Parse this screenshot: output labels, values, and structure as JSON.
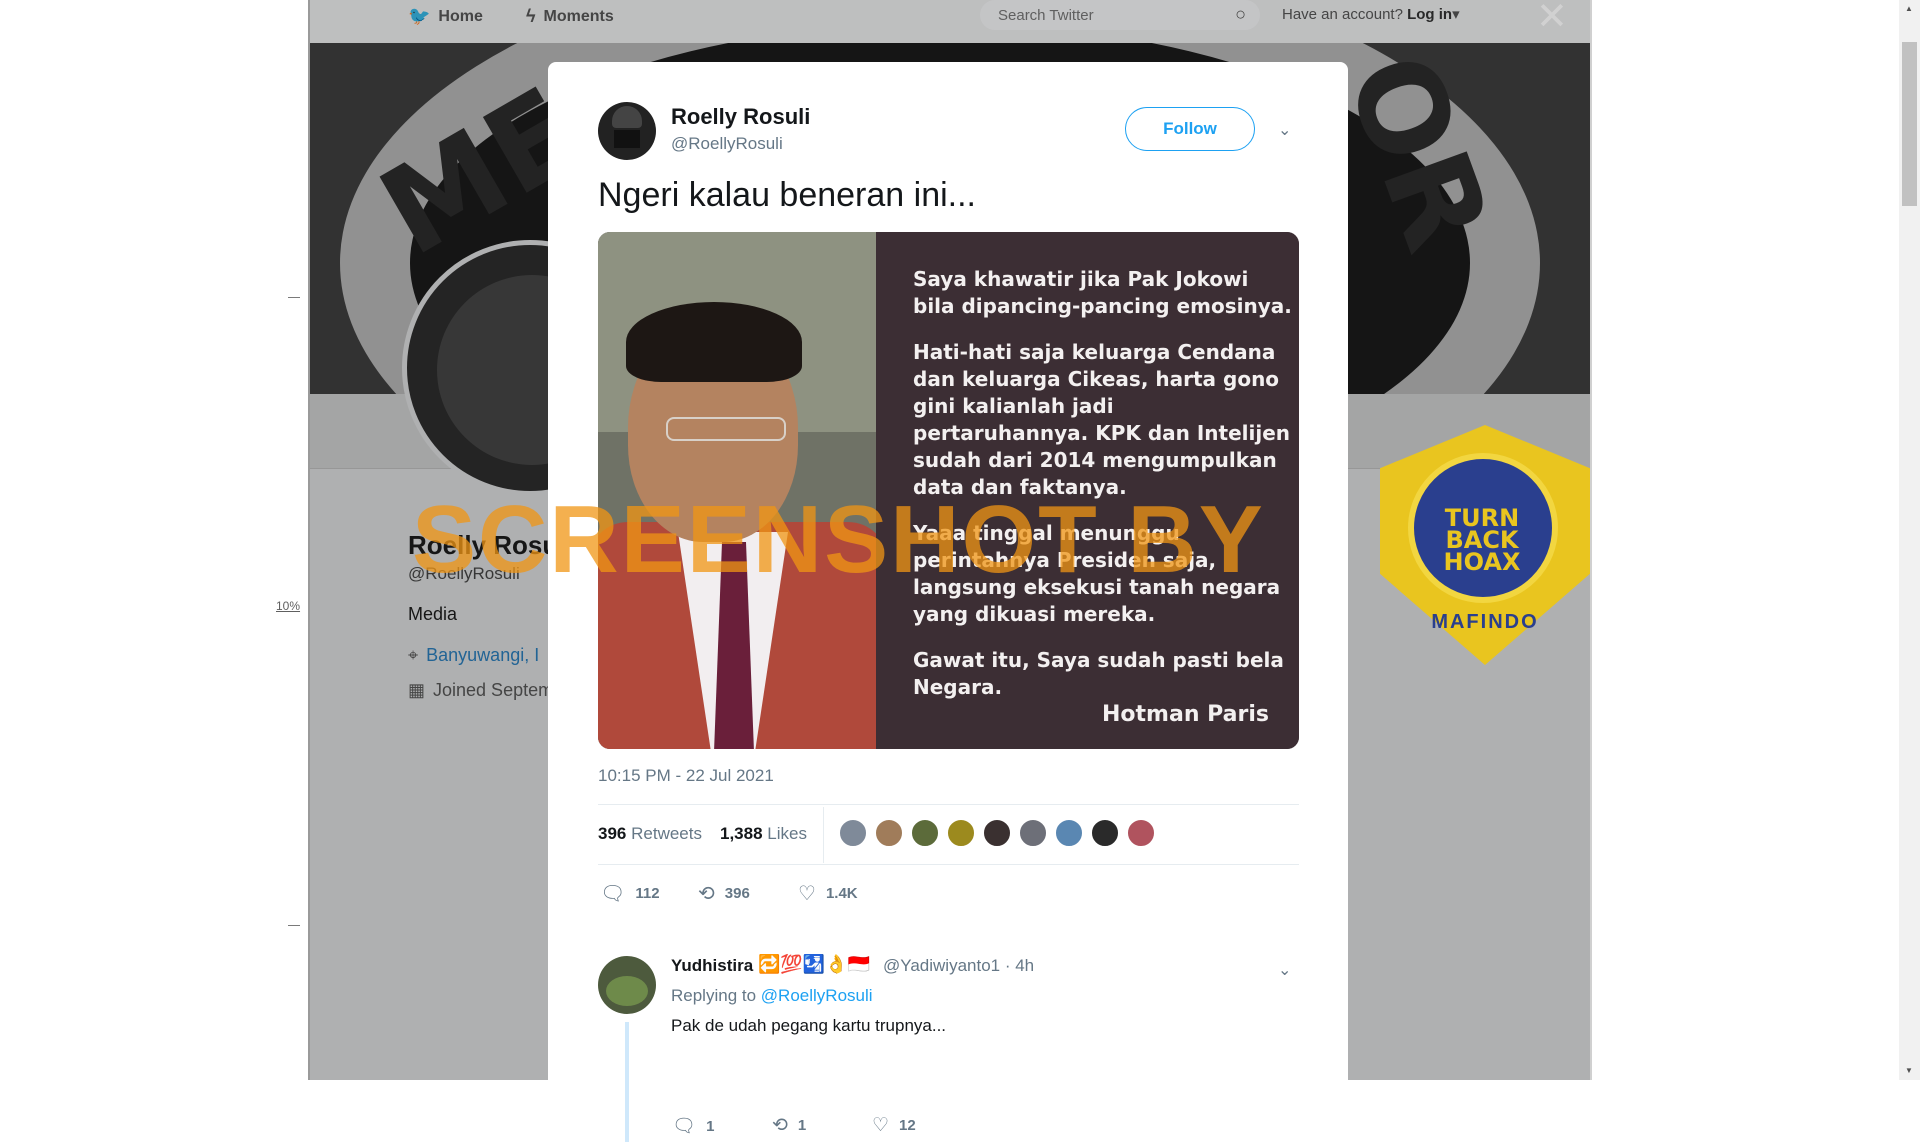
{
  "topnav": {
    "home_label": "Home",
    "moments_label": "Moments",
    "search_placeholder": "Search Twitter",
    "account_prompt": "Have an account?",
    "login_label": "Log in"
  },
  "background_profile": {
    "name": "Roelly Rosu",
    "handle": "@RoellyRosuli",
    "bio": "Media",
    "location": "Banyuwangi, I",
    "joined": "Joined Septem"
  },
  "side": {
    "zoom_label": "10%"
  },
  "tweet": {
    "author_name": "Roelly Rosuli",
    "author_handle": "@RoellyRosuli",
    "follow_label": "Follow",
    "text": "Ngeri kalau beneran ini...",
    "image_quote": [
      "Saya khawatir jika Pak Jokowi bila dipancing-pancing emosinya.",
      "Hati-hati saja keluarga Cendana dan keluarga Cikeas, harta gono gini kalianlah jadi pertaruhannya. KPK dan Intelijen sudah dari 2014 mengumpulkan data dan faktanya.",
      "Yaaa tinggal menunggu perintahnya Presiden saja, langsung eksekusi tanah negara yang dikuasi mereka.",
      "Gawat itu, Saya sudah pasti bela Negara."
    ],
    "image_author": "Hotman Paris",
    "timestamp": "10:15 PM - 22 Jul 2021",
    "retweets_count": "396",
    "retweets_label": "Retweets",
    "likes_count": "1,388",
    "likes_label": "Likes",
    "reply_count": "112",
    "retweet_count_action": "396",
    "like_count_action": "1.4K",
    "liker_colors": [
      "#7f8a99",
      "#a07c5a",
      "#5c6b3a",
      "#9c8a1e",
      "#3a3030",
      "#6d6f78",
      "#5a87b2",
      "#2a2a2a",
      "#b0535e"
    ]
  },
  "watermark": "SCREENSHOT BY",
  "badge": {
    "line1": "TURN",
    "line2": "BACK",
    "line3": "HOAX",
    "org": "MAFINDO"
  },
  "reply": {
    "name": "Yudhistira",
    "emoji": "🔁💯🛂👌🇮🇩",
    "handle_time": "@Yadiwiyanto1 · 4h",
    "replying_prefix": "Replying to",
    "replying_to": "@RoellyRosuli",
    "text": "Pak de udah pegang kartu trupnya...",
    "reply_count": "1",
    "retweet_count": "1",
    "like_count": "12"
  },
  "colors": {
    "accent": "#1da1f2",
    "watermark": "#f0961a",
    "badge_yellow": "#e9c51f",
    "badge_blue": "#2a3f8e"
  }
}
